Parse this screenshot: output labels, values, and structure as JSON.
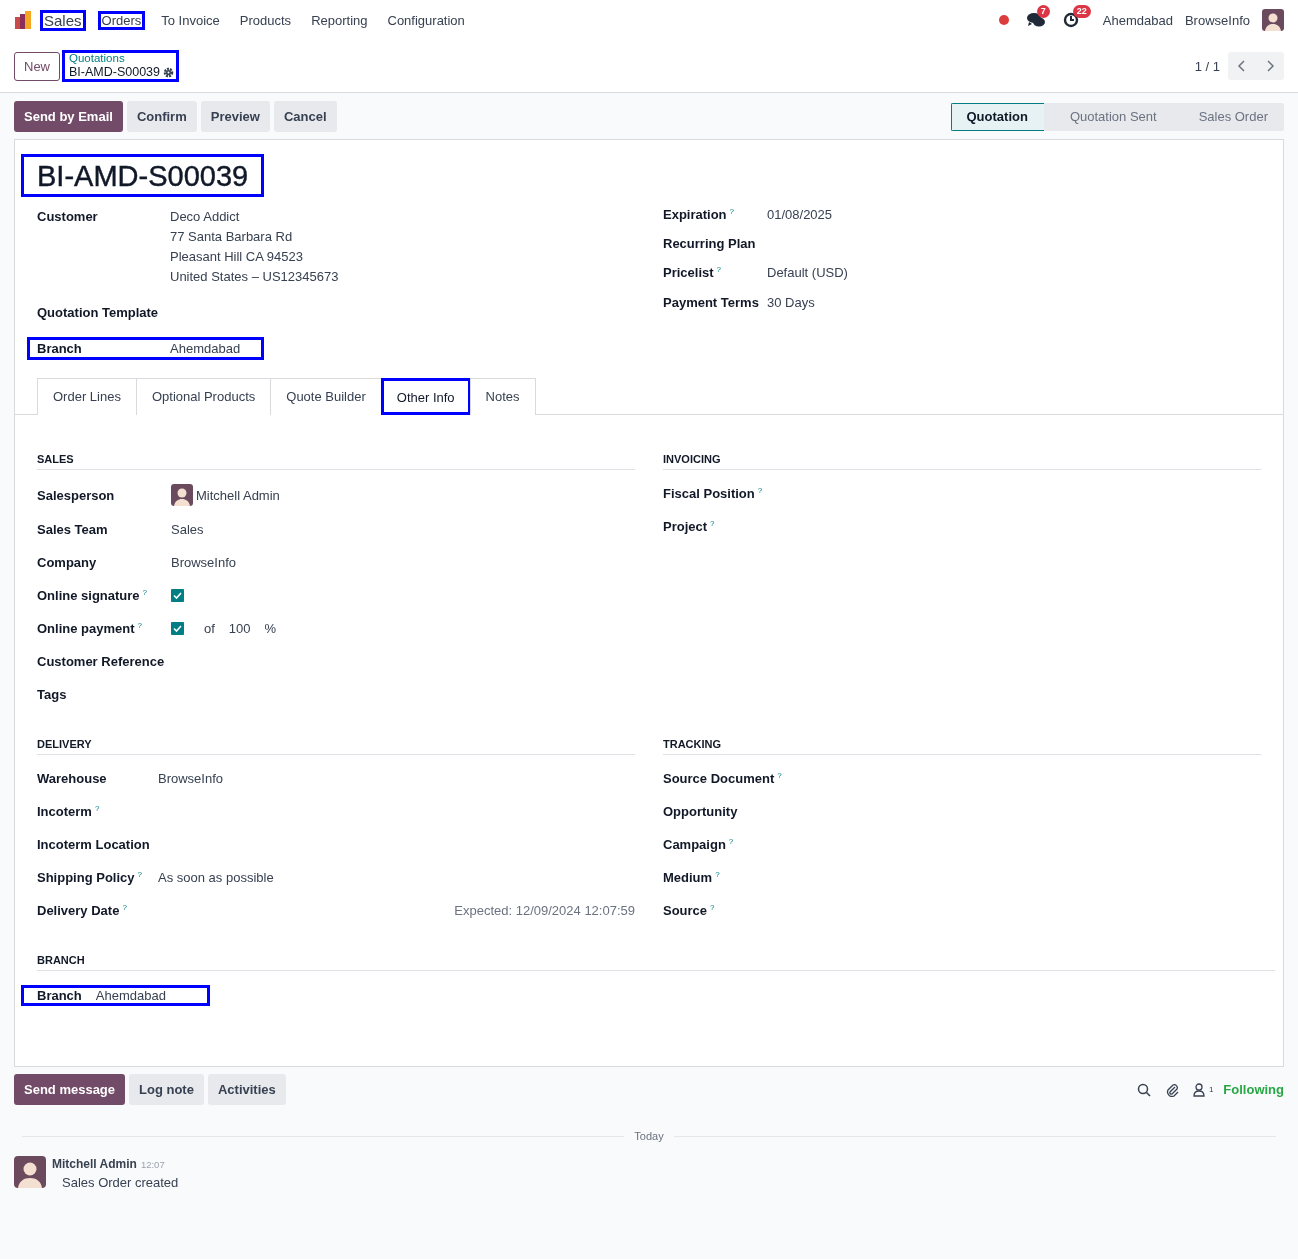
{
  "navbar": {
    "menu": [
      {
        "label": "Sales",
        "highlighted": true
      },
      {
        "label": "Orders",
        "highlighted": true
      },
      {
        "label": "To Invoice",
        "highlighted": false
      },
      {
        "label": "Products",
        "highlighted": false
      },
      {
        "label": "Reporting",
        "highlighted": false
      },
      {
        "label": "Configuration",
        "highlighted": false
      }
    ],
    "message_count": "7",
    "activity_count": "22",
    "branch": "Ahemdabad",
    "company": "BrowseInfo"
  },
  "control_panel": {
    "new_button": "New",
    "breadcrumb_parent": "Quotations",
    "breadcrumb_current": "BI-AMD-S00039",
    "breadcrumb_highlighted": true,
    "pager": "1 / 1"
  },
  "actions": [
    {
      "label": "Send by Email",
      "primary": true
    },
    {
      "label": "Confirm",
      "primary": false
    },
    {
      "label": "Preview",
      "primary": false
    },
    {
      "label": "Cancel",
      "primary": false
    }
  ],
  "status_steps": [
    {
      "label": "Quotation",
      "selected": true
    },
    {
      "label": "Quotation Sent",
      "selected": false
    },
    {
      "label": "Sales Order",
      "selected": false
    }
  ],
  "form": {
    "title": "BI-AMD-S00039",
    "title_highlighted": true,
    "left_fields": [
      {
        "label": "Customer",
        "lines": [
          "Deco Addict",
          "77 Santa Barbara Rd",
          "Pleasant Hill CA 94523",
          "United States – US12345673"
        ],
        "highlighted": false
      },
      {
        "label": "Quotation Template",
        "highlighted": false
      },
      {
        "label": "Branch",
        "lines": [
          "Ahemdabad"
        ],
        "highlighted": true
      }
    ],
    "right_fields": [
      {
        "label": "Expiration",
        "help": "?",
        "value": "01/08/2025"
      },
      {
        "label": "Recurring Plan"
      },
      {
        "label": "Pricelist",
        "help": "?",
        "value": "Default (USD)"
      },
      {
        "label": "Payment Terms",
        "value": "30 Days"
      }
    ],
    "tabs": [
      {
        "label": "Order Lines",
        "selected": false,
        "highlighted": false
      },
      {
        "label": "Optional Products",
        "selected": false,
        "highlighted": false
      },
      {
        "label": "Quote Builder",
        "selected": false,
        "highlighted": false
      },
      {
        "label": "Other Info",
        "selected": true,
        "highlighted": true
      },
      {
        "label": "Notes",
        "selected": false,
        "highlighted": false
      }
    ],
    "section_rows": [
      [
        {
          "title": "SALES",
          "fields": [
            {
              "kind": "avatar",
              "label": "Salesperson",
              "value": "Mitchell Admin"
            },
            {
              "kind": "text",
              "label": "Sales Team",
              "value": "Sales"
            },
            {
              "kind": "text",
              "label": "Company",
              "value": "BrowseInfo"
            },
            {
              "kind": "checkbox",
              "label": "Online signature",
              "help": "?",
              "checked": true
            },
            {
              "kind": "payment",
              "label": "Online payment",
              "help": "?",
              "checked": true,
              "of": "of",
              "amount": "100",
              "unit": "%"
            },
            {
              "kind": "text",
              "label": "Customer Reference"
            },
            {
              "kind": "text",
              "label": "Tags"
            }
          ]
        },
        {
          "title": "INVOICING",
          "fields": [
            {
              "kind": "text",
              "label": "Fiscal Position",
              "help": "?"
            },
            {
              "kind": "text",
              "label": "Project",
              "help": "?"
            }
          ]
        }
      ],
      [
        {
          "title": "DELIVERY",
          "fields": [
            {
              "kind": "text",
              "label": "Warehouse",
              "value": "BrowseInfo"
            },
            {
              "kind": "text",
              "label": "Incoterm",
              "help": "?"
            },
            {
              "kind": "text",
              "label": "Incoterm Location"
            },
            {
              "kind": "text",
              "label": "Shipping Policy",
              "help": "?",
              "value": "As soon as possible"
            },
            {
              "kind": "expected",
              "label": "Delivery Date",
              "help": "?",
              "value": "Expected: 12/09/2024 12:07:59"
            }
          ]
        },
        {
          "title": "TRACKING",
          "fields": [
            {
              "kind": "text",
              "label": "Source Document",
              "help": "?"
            },
            {
              "kind": "text",
              "label": "Opportunity"
            },
            {
              "kind": "text",
              "label": "Campaign",
              "help": "?"
            },
            {
              "kind": "text",
              "label": "Medium",
              "help": "?"
            },
            {
              "kind": "text",
              "label": "Source",
              "help": "?"
            }
          ]
        }
      ],
      [
        {
          "title": "BRANCH",
          "fields": [
            {
              "kind": "inline",
              "label": "Branch",
              "value": "Ahemdabad",
              "highlighted": true
            }
          ]
        }
      ]
    ]
  },
  "chatter": {
    "buttons": [
      {
        "label": "Send message",
        "primary": true
      },
      {
        "label": "Log note",
        "primary": false
      },
      {
        "label": "Activities",
        "primary": false
      }
    ],
    "follower_count": "1",
    "following": "Following",
    "separator": "Today",
    "messages": [
      {
        "author": "Mitchell Admin",
        "time": "12:07",
        "body": "Sales Order created"
      }
    ]
  }
}
